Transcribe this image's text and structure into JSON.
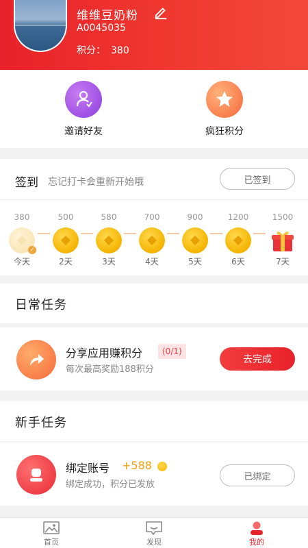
{
  "profile": {
    "name": "维维豆奶粉",
    "id": "A0045035",
    "points_label": "积分：",
    "points_value": "380"
  },
  "quick_actions": [
    {
      "label": "邀请好友",
      "icon": "invite-user-icon"
    },
    {
      "label": "疯狂积分",
      "icon": "star-icon"
    }
  ],
  "signin": {
    "title": "签到",
    "hint": "忘记打卡会重新开始哦",
    "button": "已签到",
    "days": [
      {
        "points": "380",
        "label": "今天",
        "state": "done"
      },
      {
        "points": "500",
        "label": "2天",
        "state": "coin"
      },
      {
        "points": "580",
        "label": "3天",
        "state": "coin"
      },
      {
        "points": "700",
        "label": "4天",
        "state": "coin"
      },
      {
        "points": "900",
        "label": "5天",
        "state": "coin"
      },
      {
        "points": "1200",
        "label": "6天",
        "state": "coin"
      },
      {
        "points": "1500",
        "label": "7天",
        "state": "gift"
      }
    ]
  },
  "daily_tasks": {
    "title": "日常任务",
    "items": [
      {
        "name": "分享应用赚积分",
        "progress": "(0/1)",
        "desc": "每次最高奖励188积分",
        "button": "去完成",
        "icon": "share-arrow-icon"
      }
    ]
  },
  "newbie_tasks": {
    "title": "新手任务",
    "items": [
      {
        "name": "绑定账号",
        "reward": "+588",
        "desc": "绑定成功，积分已发放",
        "button": "已绑定",
        "icon": "user-icon"
      }
    ]
  },
  "bottom_nav": [
    {
      "label": "首页",
      "icon": "image-icon",
      "active": false
    },
    {
      "label": "发现",
      "icon": "chat-icon",
      "active": false
    },
    {
      "label": "我的",
      "icon": "profile-icon",
      "active": true
    }
  ],
  "colors": {
    "brand_red": "#e8222a",
    "coin_gold": "#f5b400",
    "invite_purple": "#8c3ee0",
    "points_orange": "#f5683c"
  }
}
